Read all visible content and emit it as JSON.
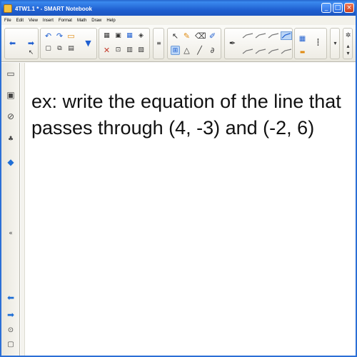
{
  "window": {
    "title": "4TW1.1 * - SMART Notebook"
  },
  "title_buttons": {
    "minimize": "_",
    "maximize": "□",
    "close": "×"
  },
  "menu": {
    "items": [
      "File",
      "Edit",
      "View",
      "Insert",
      "Format",
      "Math",
      "Draw",
      "Help"
    ]
  },
  "toolbar_icons": {
    "prev_page": "arrow-left-icon",
    "next_page": "arrow-right-icon",
    "undo": "undo-icon",
    "redo": "redo-icon",
    "delete": "delete-icon",
    "select": "select-arrow-icon",
    "pen": "pen-icon",
    "eraser": "eraser-icon",
    "line": "line-icon",
    "shape": "triangle-icon",
    "magic_pen": "magic-pen-icon",
    "fill": "fill-icon",
    "properties": "properties-icon",
    "more": "more-icon"
  },
  "sidebar_icons": [
    "page-sorter-icon",
    "gallery-icon",
    "attachments-icon",
    "properties-icon",
    "add-ons-icon",
    "collapse-icon",
    "arrow-left-icon",
    "arrow-right-icon",
    "lock-icon",
    "settings-icon"
  ],
  "colors": {
    "titlebar": "#1f5fd0",
    "accent": "#1f6fd6",
    "selected_tool": "#bcd6f6"
  },
  "board": {
    "line1": "ex: write the equation of the line that",
    "line2": "passes through (4, -3) and (-2, 6)"
  }
}
